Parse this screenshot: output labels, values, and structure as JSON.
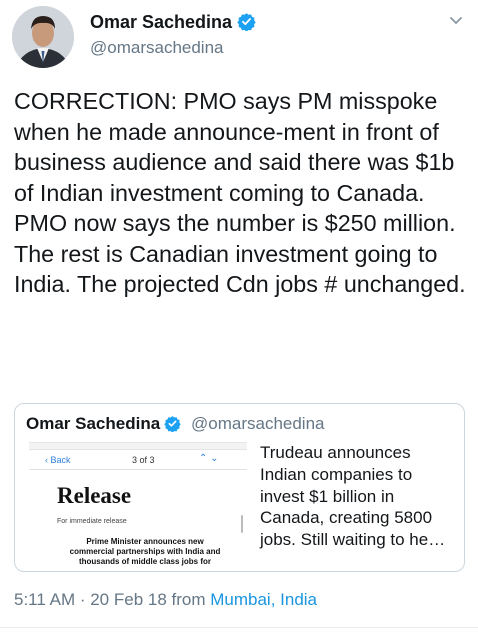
{
  "author": {
    "name": "Omar Sachedina",
    "handle": "@omarsachedina"
  },
  "tweet": {
    "text": "CORRECTION: PMO says PM misspoke when he made announce-ment in front of business audience and said there was $1b of Indian investment coming to Canada. PMO now says the number is $250 million. The rest is Canadian investment going to India. The projected Cdn jobs # unchanged."
  },
  "quoted": {
    "name": "Omar Sachedina",
    "handle": "@omarsachedina",
    "text": "Trudeau announces Indian companies to invest $1 billion in Canada, creating 5800 jobs. Still waiting to he…",
    "thumbnail": {
      "back": "‹ Back",
      "count": "3 of 3",
      "arrows": "⌃ ⌄",
      "title": "Release",
      "subtitle": "For immediate release",
      "headline": "Prime Minister announces new commercial partnerships with India and thousands of middle class jobs for"
    }
  },
  "meta": {
    "time": "5:11 AM · 20 Feb 18",
    "from": " from ",
    "location": "Mumbai, India"
  },
  "colors": {
    "verified": "#1da1f2",
    "link": "#1b95e0"
  }
}
